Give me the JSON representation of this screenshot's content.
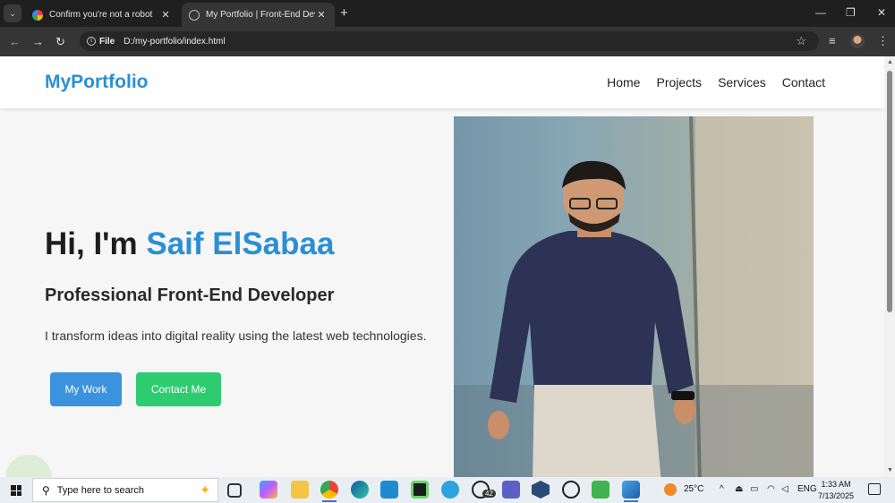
{
  "browser": {
    "tabs": [
      {
        "title": "Confirm you're not a robot",
        "active": false
      },
      {
        "title": "My Portfolio | Front-End Developer",
        "active": true
      }
    ],
    "address": {
      "chip": "File",
      "url": "D:/my-portfolio/index.html"
    }
  },
  "site": {
    "logo": "MyPortfolio",
    "nav": [
      "Home",
      "Projects",
      "Services",
      "Contact"
    ],
    "hero": {
      "greeting": "Hi, I'm ",
      "name": "Saif ElSabaa",
      "subtitle": "Professional Front-End Developer",
      "description": "I transform ideas into digital reality using the latest web technologies.",
      "buttons": {
        "work": "My Work",
        "contact": "Contact Me"
      }
    }
  },
  "taskbar": {
    "search_placeholder": "Type here to search",
    "whatsapp_badge": "42",
    "weather": "25°C",
    "lang": "ENG",
    "time": "1:33 AM",
    "date": "7/13/2025"
  },
  "colors": {
    "accent": "#2b8fd4",
    "work_button": "#3b93dd",
    "contact_button": "#2ecc71"
  }
}
